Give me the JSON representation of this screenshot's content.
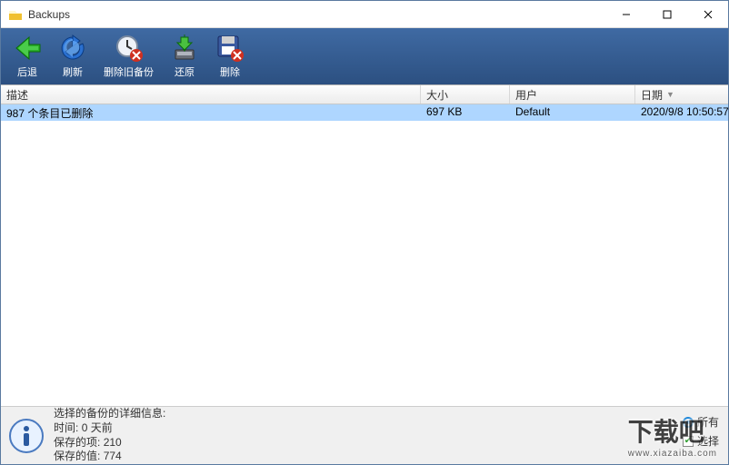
{
  "window": {
    "title": "Backups"
  },
  "toolbar": {
    "back": "后退",
    "refresh": "刷新",
    "delete_old": "删除旧备份",
    "restore": "还原",
    "delete": "删除"
  },
  "columns": {
    "description": "描述",
    "size": "大小",
    "user": "用户",
    "date": "日期"
  },
  "rows": [
    {
      "description": "987 个条目已删除",
      "size": "697 KB",
      "user": "Default",
      "date": "2020/9/8 10:50:57",
      "selected": true
    }
  ],
  "status": {
    "heading": "选择的备份的详细信息:",
    "time_label": "时间:",
    "time_value": "0 天前",
    "saved_items_label": "保存的项:",
    "saved_items_value": "210",
    "saved_values_label": "保存的值:",
    "saved_values_value": "774"
  },
  "options": {
    "all": "所有",
    "selected": "选择"
  },
  "watermark": {
    "main": "下载吧",
    "sub": "www.xiazaiba.com"
  }
}
